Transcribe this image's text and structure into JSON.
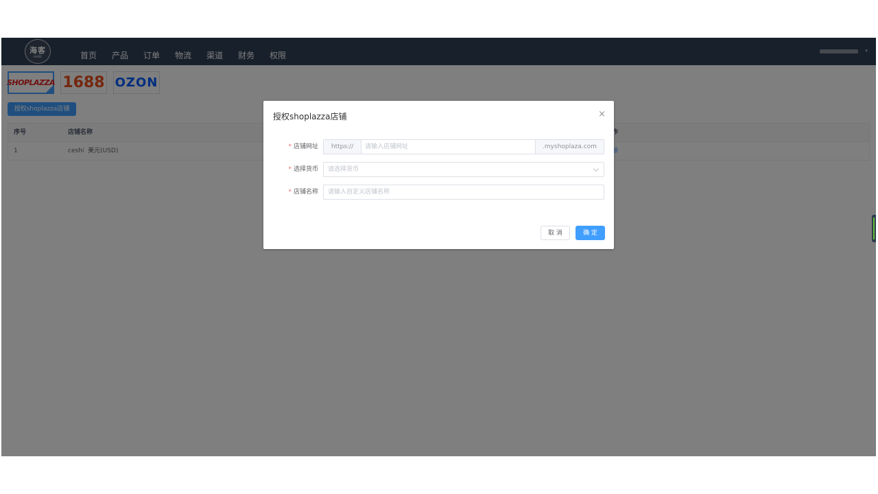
{
  "header": {
    "logo_text": "海客",
    "logo_sub": "HAIKE",
    "nav": [
      "首页",
      "产品",
      "订单",
      "物流",
      "渠道",
      "财务",
      "权限"
    ]
  },
  "platforms": [
    {
      "name": "shoplazza",
      "label": "SHOPLAZZA",
      "selected": true
    },
    {
      "name": "1688",
      "label": "1688",
      "selected": false
    },
    {
      "name": "ozon",
      "label": "OZON",
      "selected": false
    }
  ],
  "authorize_button": "授权shoplazza店铺",
  "table": {
    "columns": [
      "序号",
      "店铺名称",
      "作"
    ],
    "rows": [
      {
        "index": "1",
        "name": "ceshi",
        "currency": "美元(USD)",
        "action": "除"
      }
    ]
  },
  "dialog": {
    "title": "授权shoplazza店铺",
    "close_symbol": "×",
    "fields": {
      "url": {
        "label": "店铺网址",
        "prefix": "https://",
        "placeholder": "请输入店铺网址",
        "suffix": ".myshoplaza.com"
      },
      "currency": {
        "label": "选择货币",
        "placeholder": "请选择货币"
      },
      "name": {
        "label": "店铺名称",
        "placeholder": "请输入自定义店铺名称"
      }
    },
    "required_mark": "*",
    "cancel_label": "取 消",
    "confirm_label": "确 定"
  },
  "colors": {
    "header_bg": "#304156",
    "primary": "#409eff",
    "required": "#f56c6c",
    "overlay": "rgba(0,0,0,0.5)"
  }
}
